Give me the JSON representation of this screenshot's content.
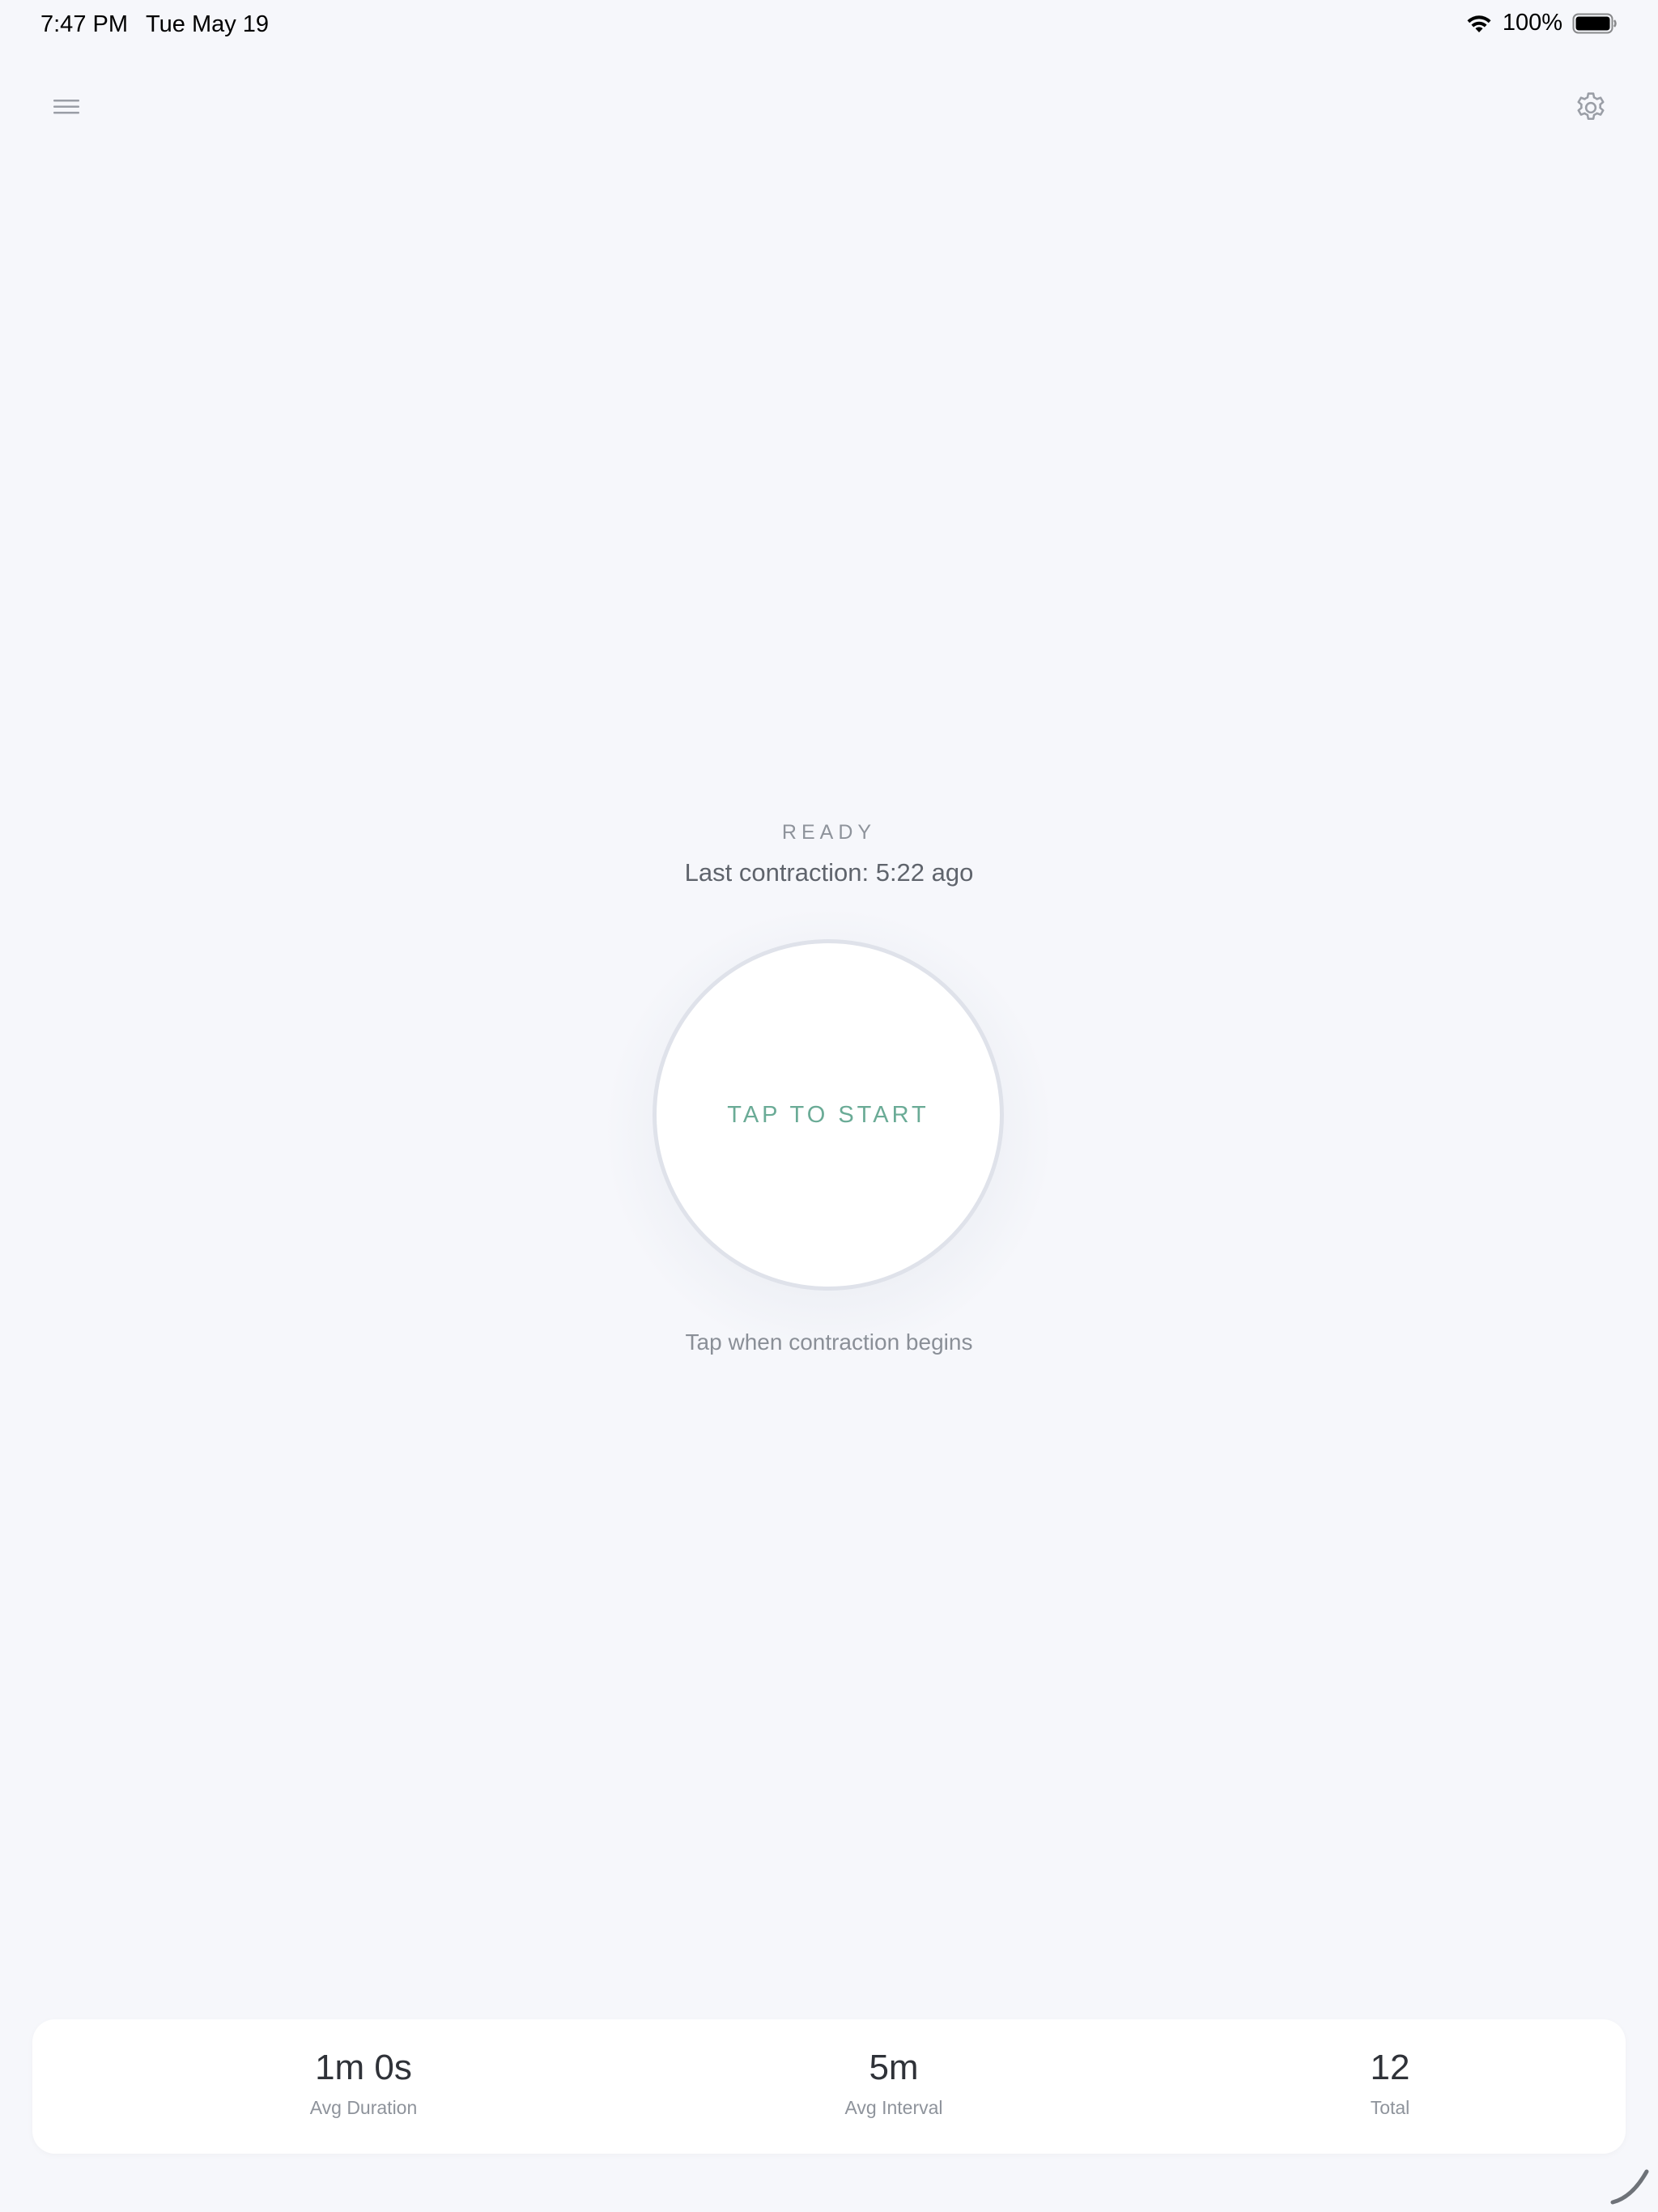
{
  "status_bar": {
    "time": "7:47 PM",
    "date": "Tue May 19",
    "battery_percent": "100%",
    "wifi_icon": "wifi-icon",
    "battery_icon": "battery-full-icon"
  },
  "toolbar": {
    "menu_icon": "hamburger-menu-icon",
    "settings_icon": "gear-icon"
  },
  "timer": {
    "status": "READY",
    "last_contraction": "Last contraction: 5:22 ago",
    "button_label": "TAP TO START",
    "hint": "Tap when contraction begins",
    "accent_color": "#6aab96"
  },
  "stats": [
    {
      "value": "1m 0s",
      "label": "Avg Duration"
    },
    {
      "value": "5m",
      "label": "Avg Interval"
    },
    {
      "value": "12",
      "label": "Total"
    }
  ]
}
